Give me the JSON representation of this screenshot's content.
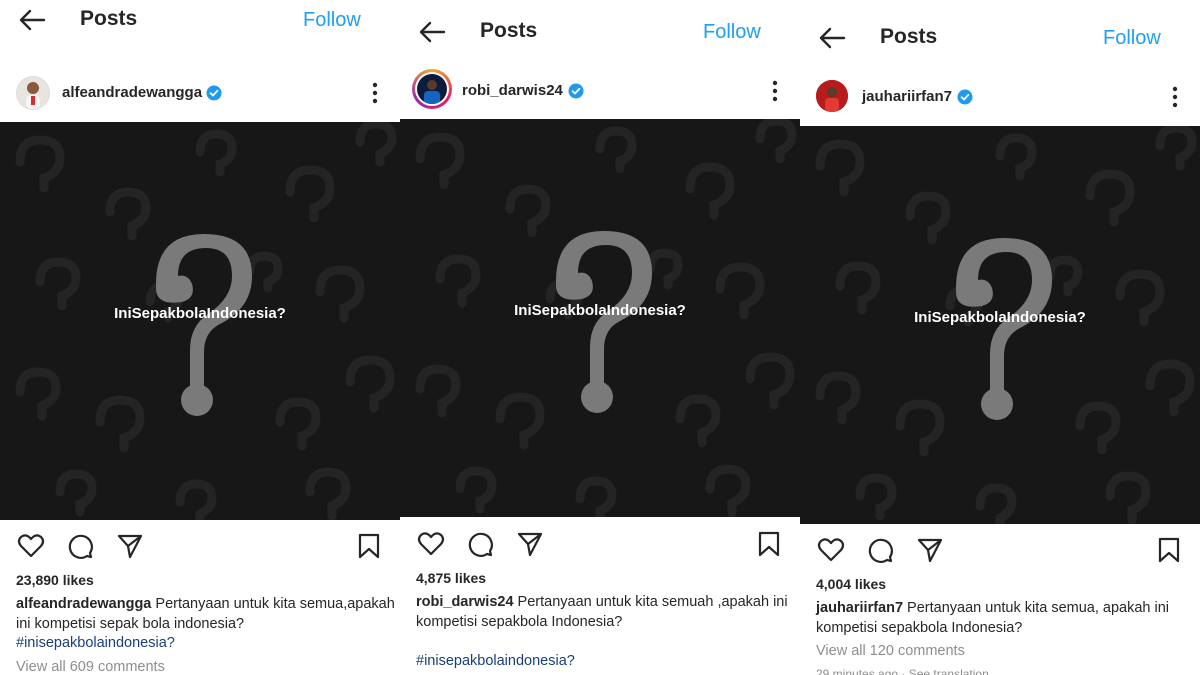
{
  "header": {
    "title": "Posts",
    "follow_label": "Follow"
  },
  "overlay_text": "IniSepakbolaIndonesia?",
  "posts": [
    {
      "username": "alfeandradewangga",
      "likes": "23,890 likes",
      "caption_user": "alfeandradewangga",
      "caption_text": " Pertanyaan untuk kita semua,apakah ini kompetisi sepak bola indonesia?",
      "hashtag": "#inisepakbolaindonesia?",
      "view_comments": "View all 609 comments"
    },
    {
      "username": "robi_darwis24",
      "likes": "4,875 likes",
      "caption_user": "robi_darwis24",
      "caption_text": " Pertanyaan untuk kita semuah ,apakah ini kompetisi sepakbola Indonesia?",
      "hashtag": "#inisepakbolaindonesia?",
      "view_comments": ""
    },
    {
      "username": "jauhariirfan7",
      "likes": "4,004 likes",
      "caption_user": "jauhariirfan7",
      "caption_text": " Pertanyaan untuk kita semua, apakah ini kompetisi sepakbola Indonesia?",
      "hashtag": "",
      "view_comments": "View all 120 comments",
      "timestamp": "29 minutes ago · See translation"
    }
  ],
  "icons": {
    "back": "arrow-left-icon",
    "verified": "verified-badge-icon",
    "more": "more-vertical-icon",
    "like": "heart-icon",
    "comment": "comment-icon",
    "share": "send-icon",
    "save": "bookmark-icon"
  },
  "colors": {
    "follow": "#1da1f2",
    "verified": "#1d9bf0",
    "image_bg": "#171717",
    "hashtag": "#1a3f7a",
    "muted": "#8e8e8e"
  }
}
